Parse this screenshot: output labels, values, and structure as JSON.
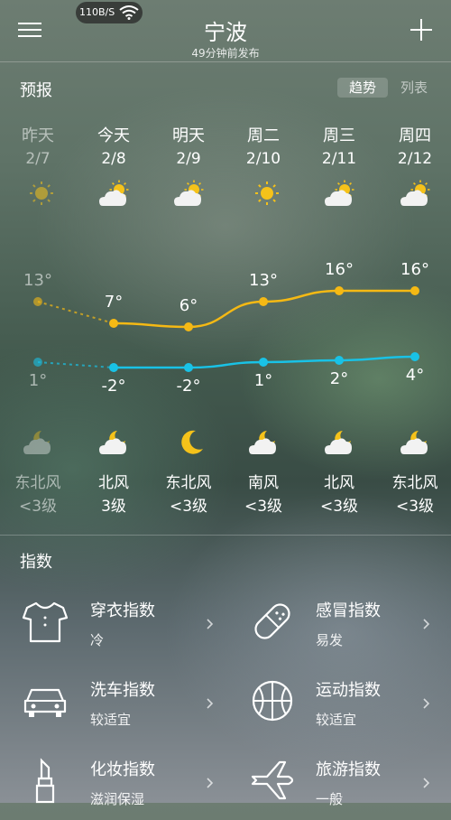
{
  "status": {
    "speed": "110B/S"
  },
  "header": {
    "city": "宁波",
    "published": "49分钟前发布"
  },
  "forecast": {
    "title": "预报",
    "view_trend": "趋势",
    "view_list": "列表",
    "days": [
      {
        "name": "昨天",
        "date": "2/7",
        "day_icon": "sun-icon",
        "night_icon": "moon-cloud-icon",
        "high": "13°",
        "low": "1°",
        "wind_dir": "东北风",
        "wind_level": "<3级",
        "past": true
      },
      {
        "name": "今天",
        "date": "2/8",
        "day_icon": "sun-cloud-icon",
        "night_icon": "moon-cloud-icon",
        "high": "7°",
        "low": "-2°",
        "wind_dir": "北风",
        "wind_level": "3级",
        "past": false
      },
      {
        "name": "明天",
        "date": "2/9",
        "day_icon": "sun-cloud-icon",
        "night_icon": "moon-icon",
        "high": "6°",
        "low": "-2°",
        "wind_dir": "东北风",
        "wind_level": "<3级",
        "past": false
      },
      {
        "name": "周二",
        "date": "2/10",
        "day_icon": "sun-icon",
        "night_icon": "moon-cloud-icon",
        "high": "13°",
        "low": "1°",
        "wind_dir": "南风",
        "wind_level": "<3级",
        "past": false
      },
      {
        "name": "周三",
        "date": "2/11",
        "day_icon": "sun-cloud-icon",
        "night_icon": "moon-cloud-icon",
        "high": "16°",
        "low": "2°",
        "wind_dir": "北风",
        "wind_level": "<3级",
        "past": false
      },
      {
        "name": "周四",
        "date": "2/12",
        "day_icon": "sun-cloud-icon",
        "night_icon": "moon-cloud-icon",
        "high": "16°",
        "low": "4°",
        "wind_dir": "东北风",
        "wind_level": "<3级",
        "past": false
      }
    ]
  },
  "chart_data": {
    "type": "line",
    "categories": [
      "2/7",
      "2/8",
      "2/9",
      "2/10",
      "2/11",
      "2/12"
    ],
    "series": [
      {
        "values": [
          13,
          7,
          6,
          13,
          16,
          16
        ],
        "color": "#f5b914"
      },
      {
        "values": [
          1,
          -2,
          -2,
          1,
          2,
          4
        ],
        "color": "#19c2e6"
      }
    ]
  },
  "indices": {
    "title": "指数",
    "items": [
      {
        "name": "穿衣指数",
        "value": "冷",
        "icon": "shirt-icon"
      },
      {
        "name": "感冒指数",
        "value": "易发",
        "icon": "pill-icon"
      },
      {
        "name": "洗车指数",
        "value": "较适宜",
        "icon": "car-icon"
      },
      {
        "name": "运动指数",
        "value": "较适宜",
        "icon": "ball-icon"
      },
      {
        "name": "化妆指数",
        "value": "滋润保湿",
        "icon": "lipstick-icon"
      },
      {
        "name": "旅游指数",
        "value": "一般",
        "icon": "plane-icon"
      }
    ]
  }
}
